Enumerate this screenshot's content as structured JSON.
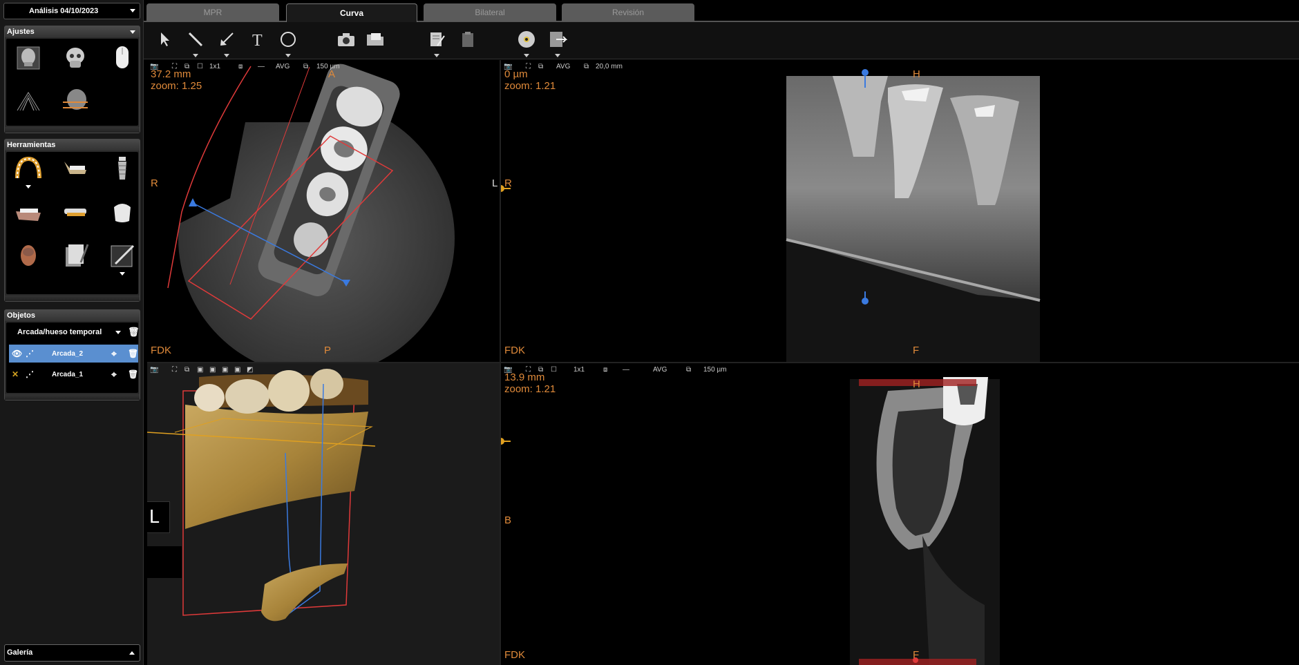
{
  "analysis": {
    "label": "Análisis 04/10/2023"
  },
  "tabs": [
    {
      "label": "MPR",
      "active": false
    },
    {
      "label": "Curva",
      "active": true
    },
    {
      "label": "Bilateral",
      "active": false
    },
    {
      "label": "Revisión",
      "active": false
    }
  ],
  "sidebar": {
    "ajustes": {
      "title": "Ajustes",
      "icons": [
        "skull-front-icon",
        "skull-3d-icon",
        "mouse-icon",
        "panoramic-icon",
        "head-slice-icon"
      ]
    },
    "herramientas": {
      "title": "Herramientas",
      "icons": [
        "dental-arch-icon",
        "mandible-icon",
        "implant-icon",
        "lower-jaw-icon",
        "splint-icon",
        "crown-icon",
        "face-3d-icon",
        "report-pages-icon",
        "annotate-icon"
      ]
    },
    "objetos": {
      "title": "Objetos",
      "selector": "Arcada/hueso temporal",
      "items": [
        {
          "name": "Arcada_2",
          "selected": true
        },
        {
          "name": "Arcada_1",
          "selected": false
        }
      ]
    },
    "galeria": {
      "title": "Galería"
    }
  },
  "toolbar": {
    "icons": [
      "arrow-pointer-icon",
      "line-measure-icon",
      "arrow-annotation-icon",
      "text-icon",
      "ellipse-icon",
      "camera-icon",
      "folder-icon",
      "document-edit-icon",
      "clipboard-icon",
      "disc-icon",
      "export-icon"
    ]
  },
  "viewports": {
    "axial": {
      "bar": {
        "layout": "1x1",
        "mode": "AVG",
        "thickness": "150 µm"
      },
      "distance": "37.2 mm",
      "zoom": "zoom: 1.25",
      "top": "A",
      "bottom": "P",
      "left": "R",
      "right": "L",
      "corner": "FDK"
    },
    "panoramic": {
      "bar": {
        "mode": "AVG",
        "thickness": "20,0 mm"
      },
      "distance": "0 µm",
      "zoom": "zoom: 1.21",
      "top": "H",
      "bottom": "F",
      "left": "R",
      "corner": "FDK"
    },
    "volume": {
      "orientation_cube": "L"
    },
    "cross": {
      "bar": {
        "layout": "1x1",
        "mode": "AVG",
        "thickness": "150 µm"
      },
      "distance": "13.9 mm",
      "zoom": "zoom: 1.21",
      "top": "H",
      "bottom": "F",
      "left": "B",
      "corner": "FDK"
    }
  },
  "colors": {
    "overlay": "#e08a3a",
    "selection": "#5a8fd0",
    "curve": "#e03a3a",
    "axis": "#3a7ae0"
  }
}
